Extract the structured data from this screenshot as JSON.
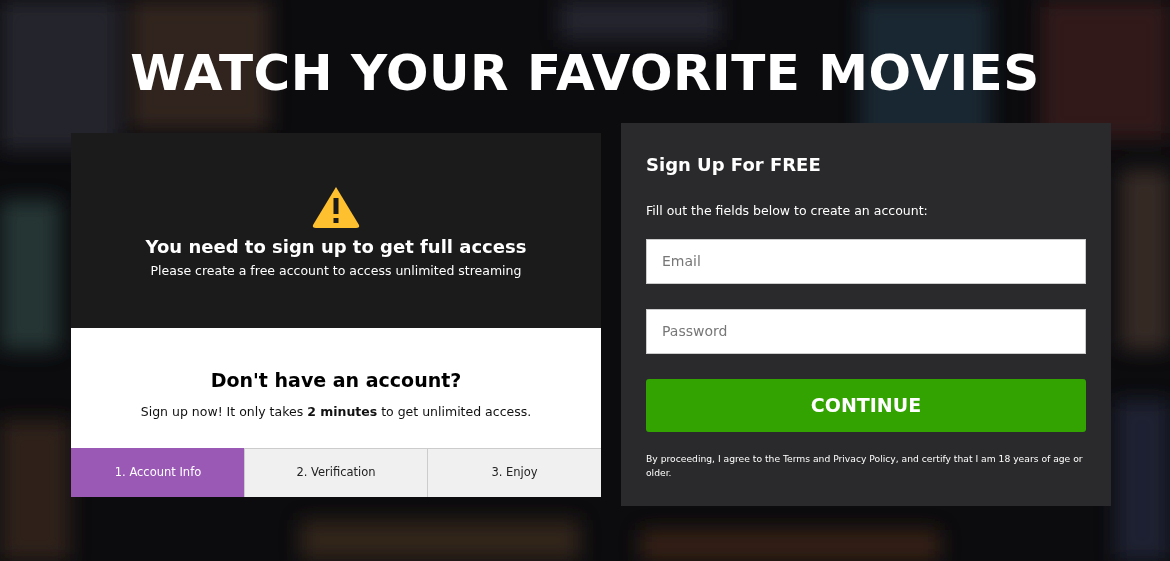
{
  "headline": "WATCH YOUR FAVORITE MOVIES",
  "notice": {
    "title": "You need to sign up to get full access",
    "subtitle": "Please create a free account to access unlimited streaming"
  },
  "prompt": {
    "title": "Don't have an account?",
    "text": "Sign up now! It only takes **2 minutes** to get unlimited access."
  },
  "steps": [
    {
      "label": "1. Account Info",
      "selected": true
    },
    {
      "label": "2. Verification",
      "selected": false
    },
    {
      "label": "3. Enjoy",
      "selected": false
    }
  ],
  "signup": {
    "title": "Sign Up For FREE",
    "instructions": "Fill out the fields below to create an account:",
    "fields": [
      {
        "placeholder": "Email"
      },
      {
        "placeholder": "Password"
      }
    ],
    "button": "CONTINUE",
    "legal": "By proceeding, I agree to the Terms and Privacy Policy, and certify that I am 18 years of age or older."
  }
}
